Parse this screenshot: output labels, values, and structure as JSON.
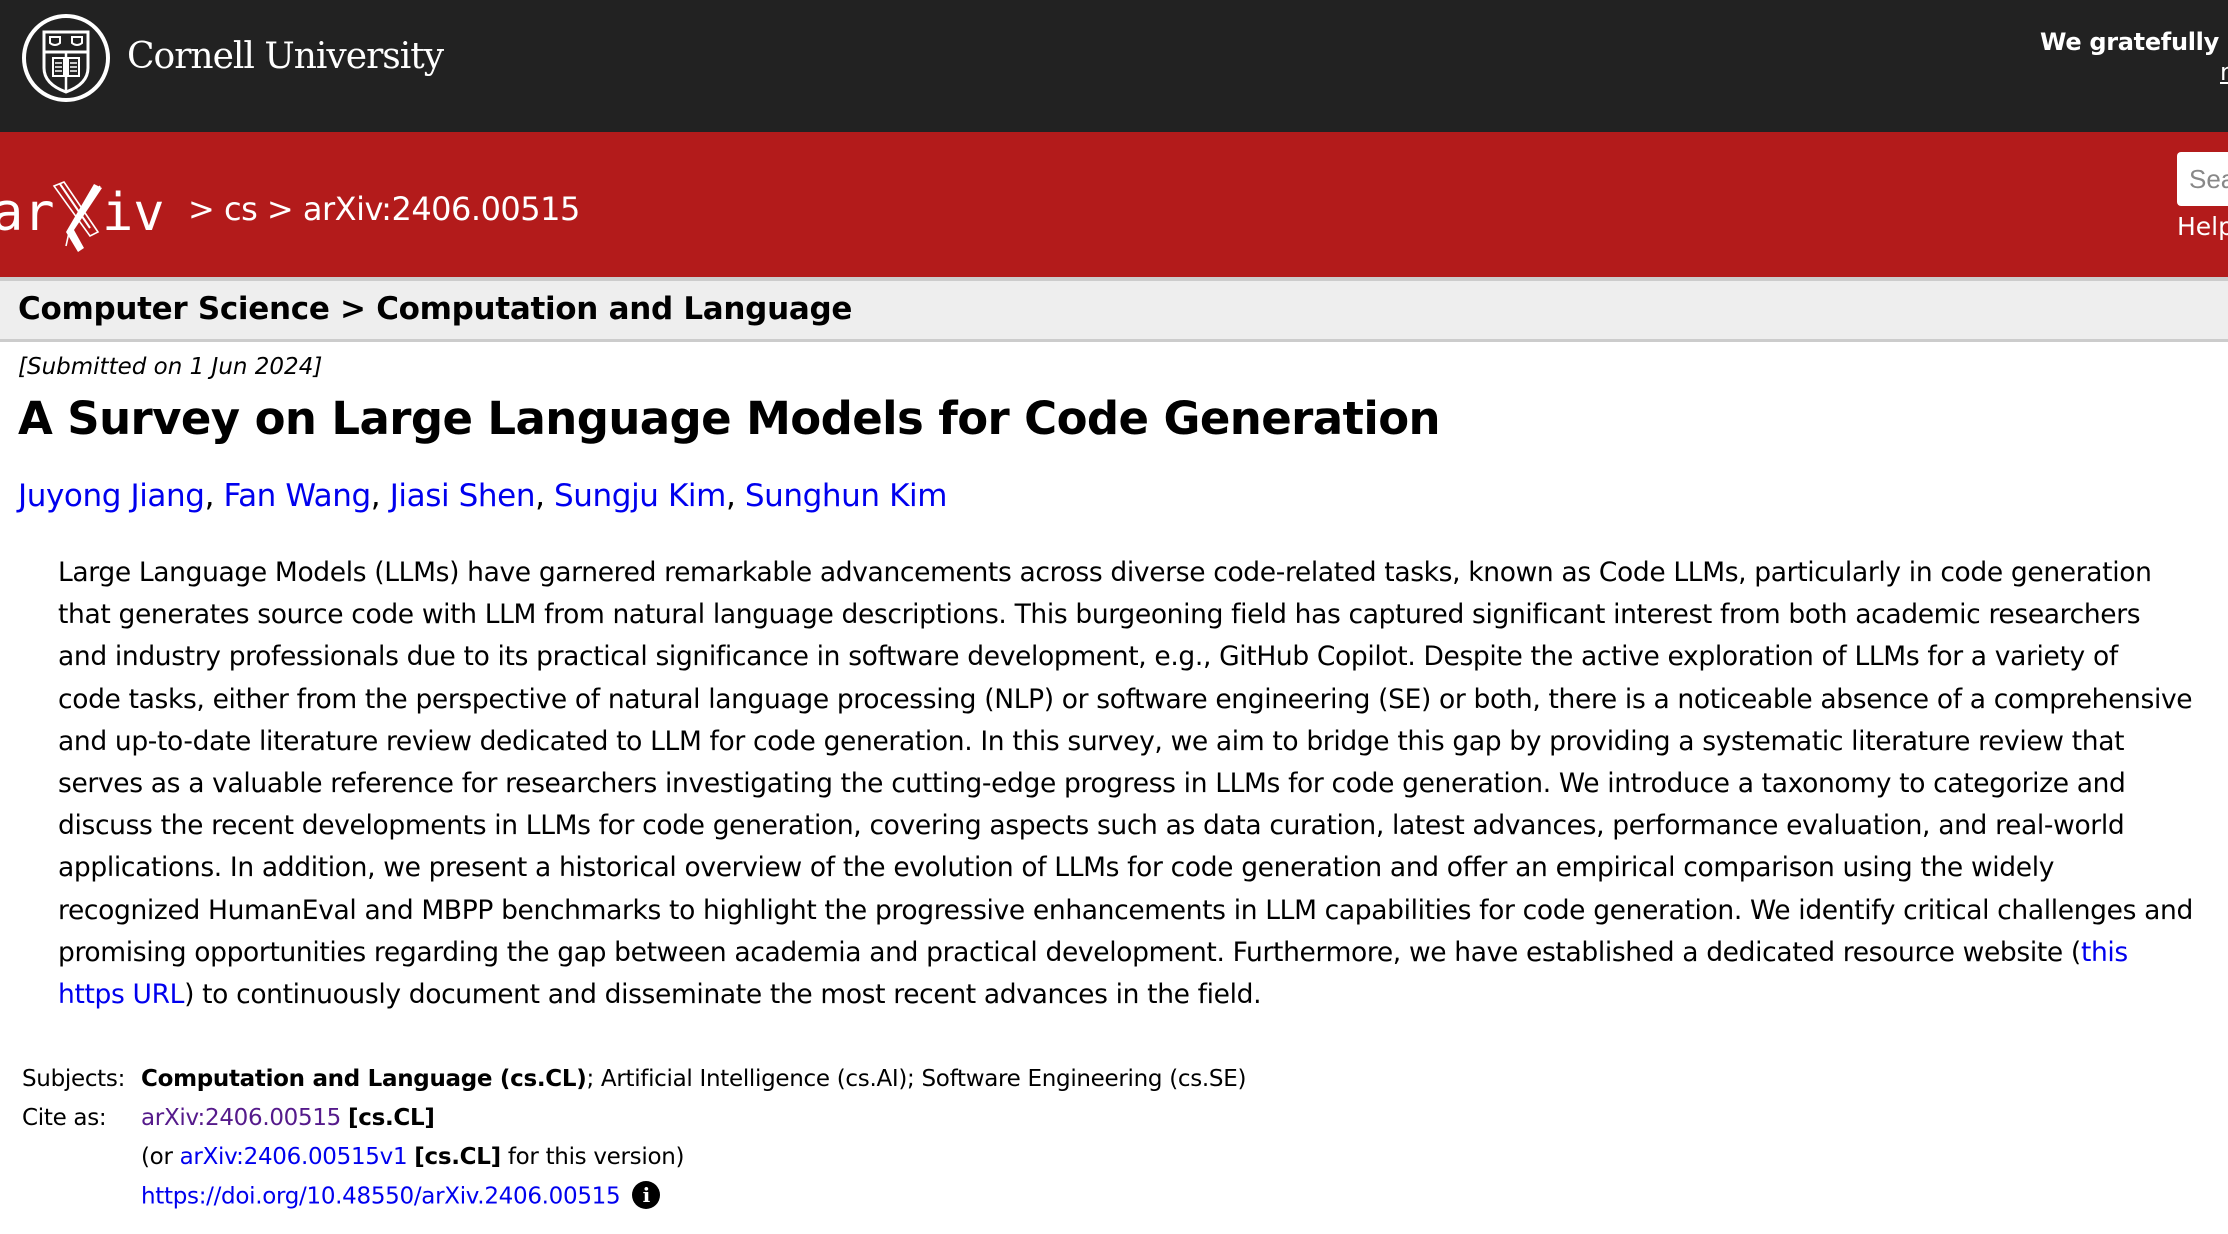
{
  "header": {
    "institution": "Cornell University",
    "acknowledgement": "We gratefully ac",
    "acknowledgement_link": "m"
  },
  "nav": {
    "logo_text": "arXiv",
    "breadcrumb": [
      " > ",
      "cs",
      " > ",
      "arXiv:2406.00515"
    ],
    "search_placeholder": "Search...",
    "help_label": "Help"
  },
  "subheader": {
    "text": "Computer Science > Computation and Language"
  },
  "paper": {
    "submitted": "[Submitted on 1 Jun 2024]",
    "title": "A Survey on Large Language Models for Code Generation",
    "authors": [
      "Juyong Jiang",
      "Fan Wang",
      "Jiasi Shen",
      "Sungju Kim",
      "Sunghun Kim"
    ],
    "author_separator": ", ",
    "abstract_lines": [
      "Large Language Models (LLMs) have garnered remarkable advancements across diverse code-related tasks, known as Code LLMs, particularly in code generation",
      "that generates source code with LLM from natural language descriptions. This burgeoning field has captured significant interest from both academic researchers",
      "and industry professionals due to its practical significance in software development, e.g., GitHub Copilot. Despite the active exploration of LLMs for a variety of",
      "code tasks, either from the perspective of natural language processing (NLP) or software engineering (SE) or both, there is a noticeable absence of a comprehensive",
      "and up-to-date literature review dedicated to LLM for code generation. In this survey, we aim to bridge this gap by providing a systematic literature review that",
      "serves as a valuable reference for researchers investigating the cutting-edge progress in LLMs for code generation. We introduce a taxonomy to categorize and",
      "discuss the recent developments in LLMs for code generation, covering aspects such as data curation, latest advances, performance evaluation, and real-world",
      "applications. In addition, we present a historical overview of the evolution of LLMs for code generation and offer an empirical comparison using the widely",
      "recognized HumanEval and MBPP benchmarks to highlight the progressive enhancements in LLM capabilities for code generation. We identify critical challenges and",
      "promising opportunities regarding the gap between academia and practical development. Furthermore, we have established a dedicated resource website ("
    ],
    "abstract_link_part1": "this",
    "abstract_link_part2": "https URL",
    "abstract_tail": ") to continuously document and disseminate the most recent advances in the field."
  },
  "metadata": {
    "subjects_label": "Subjects:",
    "subject_primary": "Computation and Language (cs.CL)",
    "subject_rest": "; Artificial Intelligence (cs.AI); Software Engineering (cs.SE)",
    "cite_label": "Cite as:",
    "cite_id": "arXiv:2406.00515",
    "cite_cat": "[cs.CL]",
    "version_prefix": "(or ",
    "version_id": "arXiv:2406.00515v1",
    "version_cat": "[cs.CL]",
    "version_suffix": " for this version)",
    "doi": "https://doi.org/10.48550/arXiv.2406.00515",
    "info_icon": "i"
  },
  "colors": {
    "topbar": "#222222",
    "brand_red": "#b31b1b",
    "subheader_bg": "#eeeeee",
    "link": "#0000ee",
    "visited_link": "#551a8b"
  }
}
